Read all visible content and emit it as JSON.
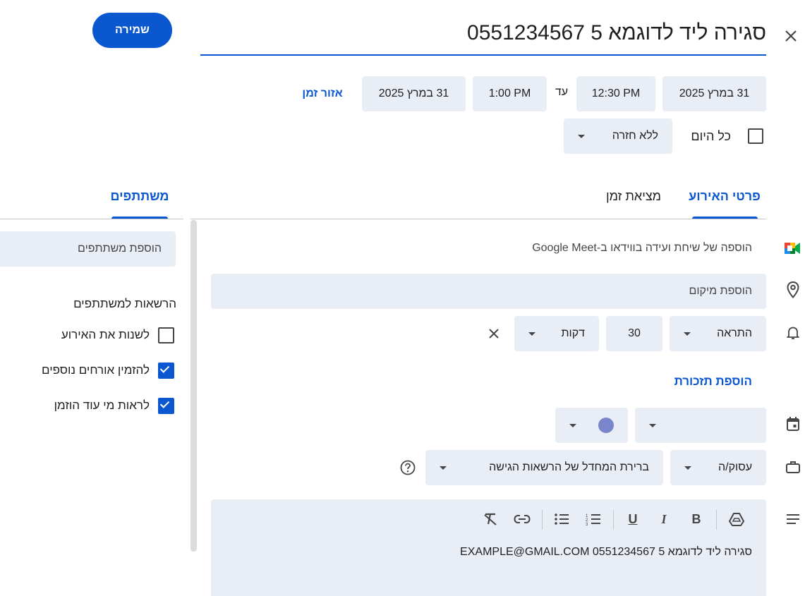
{
  "header": {
    "close_label": "✕",
    "title": "סגירה ליד לדוגמא 5 0551234567",
    "save_label": "שמירה"
  },
  "datetime": {
    "start_date": "31 במרץ 2025",
    "start_time": "12:30 PM",
    "to_label": "עד",
    "end_time": "1:00 PM",
    "end_date": "31 במרץ 2025",
    "timezone_label": "אזור זמן",
    "all_day_label": "כל היום",
    "repeat_value": "ללא חזרה"
  },
  "tabs": {
    "event_details": "פרטי האירוע",
    "find_time": "מציאת זמן",
    "participants": "משתתפים"
  },
  "details": {
    "meet_label": "הוספה של שיחת ועידה בווידאו ב-Google Meet",
    "location_placeholder": "הוספת מיקום",
    "notification_type": "התראה",
    "notification_value": "30",
    "notification_unit": "דקות",
    "add_notification": "הוספת תזכורת",
    "calendar_value": "",
    "event_color": "#7986cb",
    "busy_value": "עסוק/ה",
    "visibility_value": "ברירת המחדל של הרשאות הגישה",
    "description_text": "סגירה ליד לדוגמא 5 0551234567 EXAMPLE@GMAIL.COM"
  },
  "participants": {
    "add_placeholder": "הוספת משתתפים",
    "permissions_title": "הרשאות למשתתפים",
    "permissions": [
      {
        "label": "לשנות את האירוע",
        "checked": false
      },
      {
        "label": "להזמין אורחים נוספים",
        "checked": true
      },
      {
        "label": "לראות מי עוד הוזמן",
        "checked": true
      }
    ]
  },
  "colors": {
    "accent": "#0b57d0",
    "field_bg": "#e9eef6"
  }
}
